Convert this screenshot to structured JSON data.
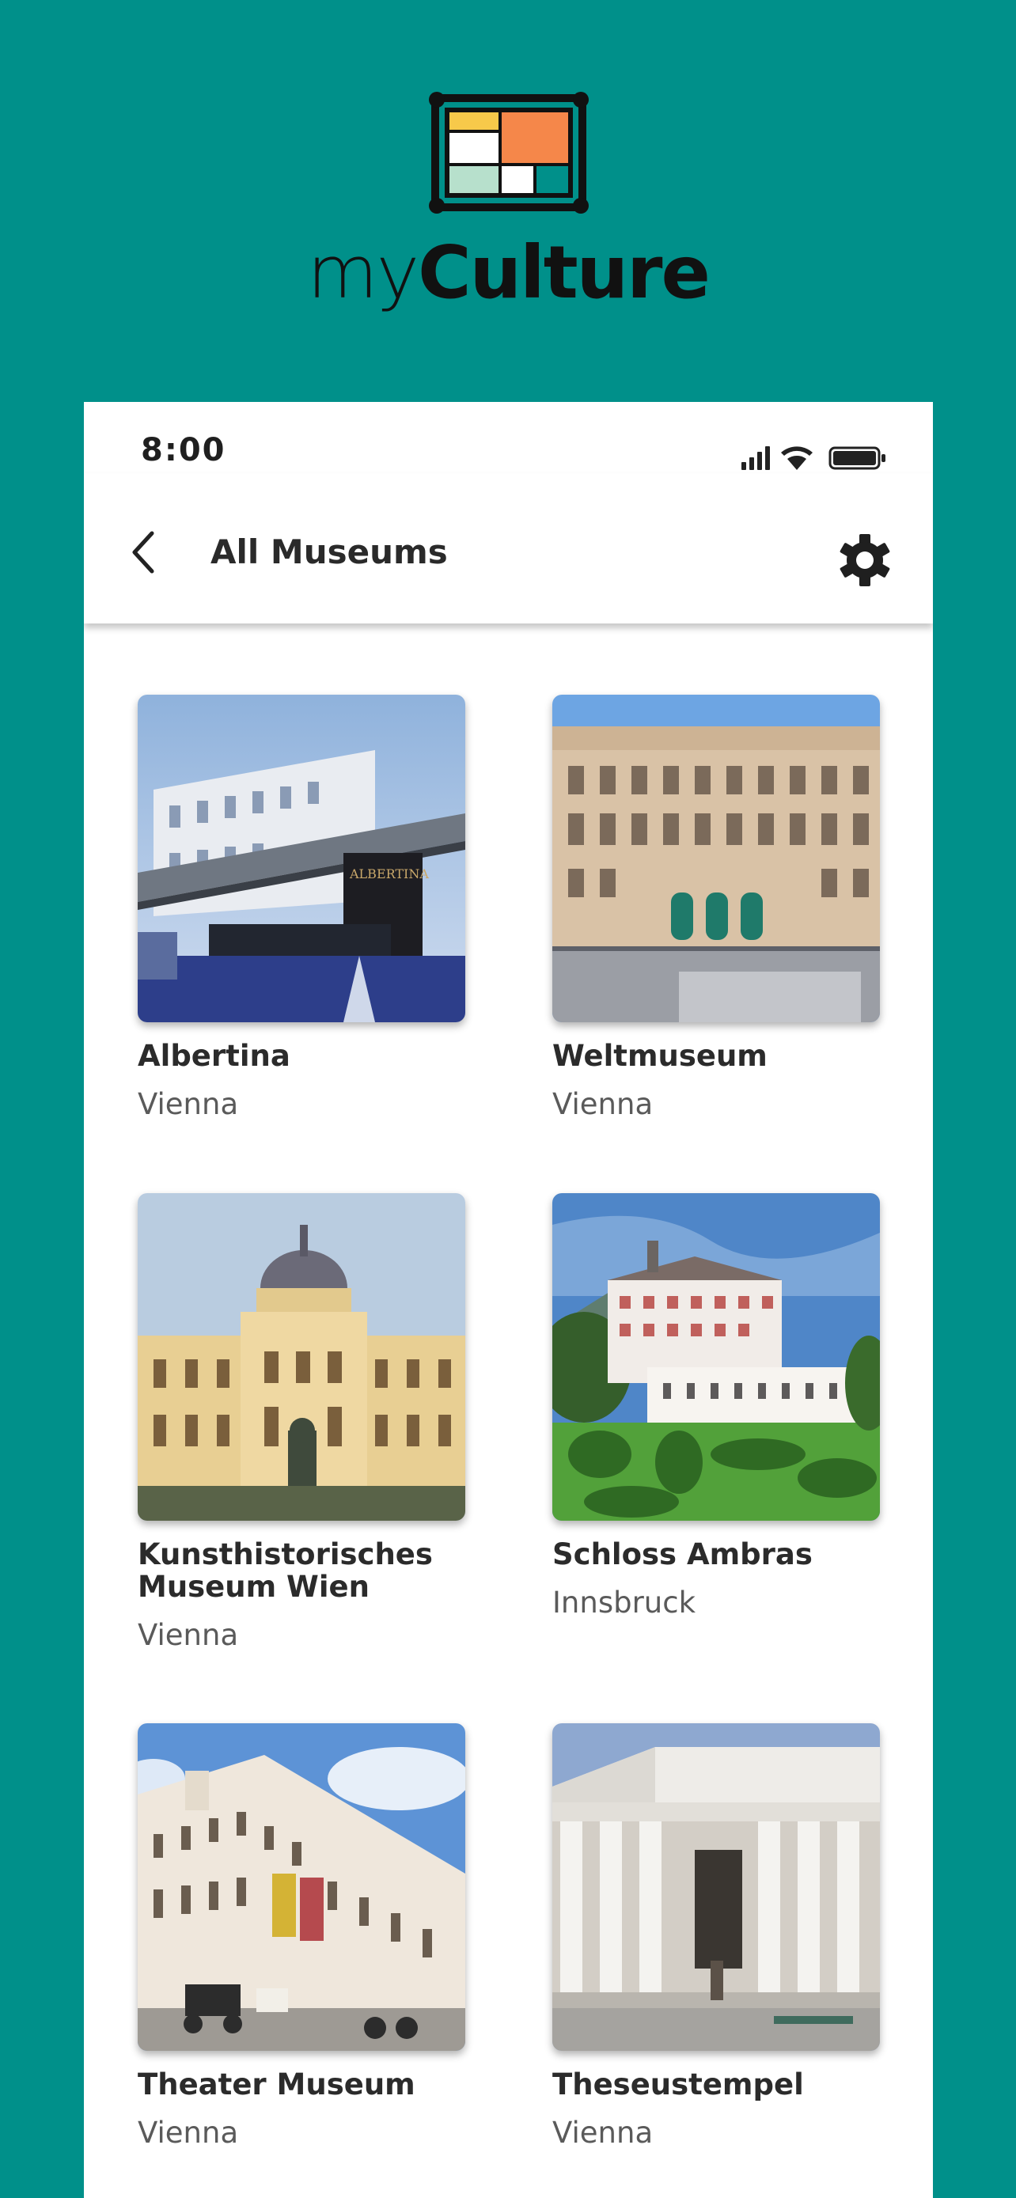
{
  "brand": {
    "name_light": "my",
    "name_bold": "Culture"
  },
  "status_bar": {
    "time": "8:00"
  },
  "app_bar": {
    "title": "All Museums"
  },
  "museums": [
    {
      "name": "Albertina",
      "city": "Vienna"
    },
    {
      "name": "Weltmuseum",
      "city": "Vienna"
    },
    {
      "name": "Kunsthistorisches Museum Wien",
      "city": "Vienna"
    },
    {
      "name": "Schloss Ambras",
      "city": "Innsbruck"
    },
    {
      "name": "Theater Museum",
      "city": "Vienna"
    },
    {
      "name": "Theseustempel",
      "city": "Vienna"
    }
  ],
  "colors": {
    "background": "#00908a",
    "card": "#ffffff",
    "logo_orange": "#f5874a",
    "logo_yellow": "#f7c94a"
  }
}
